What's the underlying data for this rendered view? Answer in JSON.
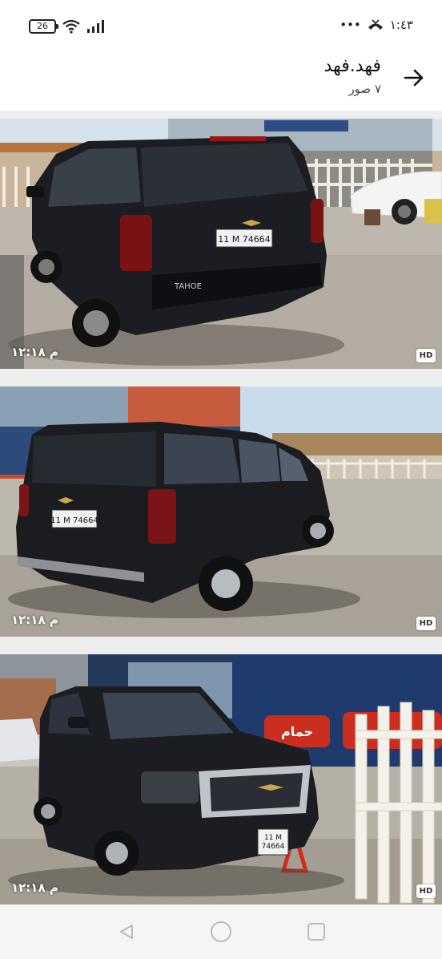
{
  "status_bar": {
    "battery": "26",
    "time": "١:٤٣",
    "dots": "•••"
  },
  "header": {
    "title": "فهد.فهد",
    "subtitle": "٧ صور",
    "back_icon": "arrow-right-icon"
  },
  "photos": [
    {
      "timestamp": "م ١٢:١٨",
      "badge": "HD",
      "plate": "11 M 74664",
      "badge_text": "TAHOE"
    },
    {
      "timestamp": "م ١٢:١٨",
      "badge": "HD",
      "plate": "11 M 74664"
    },
    {
      "timestamp": "م ١٢:١٨",
      "badge": "HD",
      "plate": "11 M\n74664",
      "banner": "حمام"
    }
  ],
  "nav": {
    "back_icon": "triangle-back-icon",
    "home_icon": "circle-home-icon",
    "recents_icon": "square-recents-icon"
  }
}
